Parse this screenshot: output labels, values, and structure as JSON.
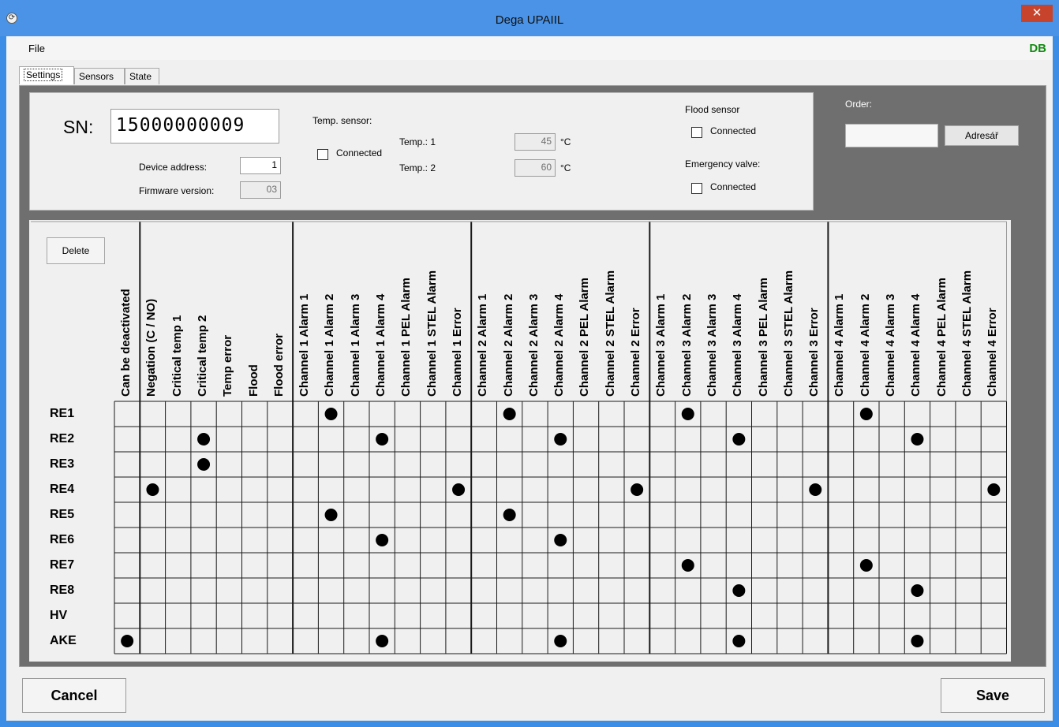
{
  "window": {
    "title": "Dega UPAIIL",
    "close_glyph": "✕",
    "icon": "refresh-app-icon"
  },
  "menu": {
    "file": "File",
    "db_badge": "DB"
  },
  "tabs": [
    "Settings",
    "Sensors",
    "State"
  ],
  "settings": {
    "sn_label": "SN:",
    "sn_value": "15000000009",
    "device_address_label": "Device address:",
    "device_address_value": "1",
    "firmware_label": "Firmware version:",
    "firmware_value": "03",
    "temp_sensor_label": "Temp. sensor:",
    "temp_connected_label": "Connected",
    "temp1_label": "Temp.: 1",
    "temp1_value": "45",
    "temp2_label": "Temp.: 2",
    "temp2_value": "60",
    "unit": "°C",
    "flood_sensor_label": "Flood sensor",
    "flood_connected_label": "Connected",
    "emergency_valve_label": "Emergency valve:",
    "valve_connected_label": "Connected",
    "order_label": "Order:",
    "order_value": "",
    "adresar_label": "Adresář"
  },
  "grid": {
    "delete_label": "Delete",
    "columns": [
      "Can be deactivated",
      "Negation (C / NO)",
      "Critical temp 1",
      "Critical temp 2",
      "Temp error",
      "Flood",
      "Flood error",
      "Channel 1 Alarm 1",
      "Channel 1 Alarm 2",
      "Channel 1 Alarm 3",
      "Channel 1 Alarm 4",
      "Channel 1 PEL Alarm",
      "Channel 1 STEL Alarm",
      "Channel 1 Error",
      "Channel 2 Alarm 1",
      "Channel 2 Alarm 2",
      "Channel 2 Alarm 3",
      "Channel 2 Alarm 4",
      "Channel 2 PEL Alarm",
      "Channel 2 STEL Alarm",
      "Channel 2 Error",
      "Channel 3 Alarm 1",
      "Channel 3 Alarm 2",
      "Channel 3 Alarm 3",
      "Channel 3 Alarm 4",
      "Channel 3 PEL Alarm",
      "Channel 3 STEL Alarm",
      "Channel 3 Error",
      "Channel 4 Alarm 1",
      "Channel 4 Alarm 2",
      "Channel 4 Alarm 3",
      "Channel 4 Alarm 4",
      "Channel 4 PEL Alarm",
      "Channel 4 STEL Alarm",
      "Channel 4 Error"
    ],
    "rows": [
      "RE1",
      "RE2",
      "RE3",
      "RE4",
      "RE5",
      "RE6",
      "RE7",
      "RE8",
      "HV",
      "AKE"
    ],
    "marks": [
      [
        8,
        15,
        22,
        29
      ],
      [
        3,
        10,
        17,
        24,
        31
      ],
      [
        3
      ],
      [
        1,
        13,
        20,
        27,
        34
      ],
      [
        8,
        15
      ],
      [
        10,
        17
      ],
      [
        22,
        29
      ],
      [
        24,
        31
      ],
      [],
      [
        0,
        10,
        17,
        24,
        31
      ]
    ]
  },
  "footer": {
    "cancel_label": "Cancel",
    "save_label": "Save"
  }
}
